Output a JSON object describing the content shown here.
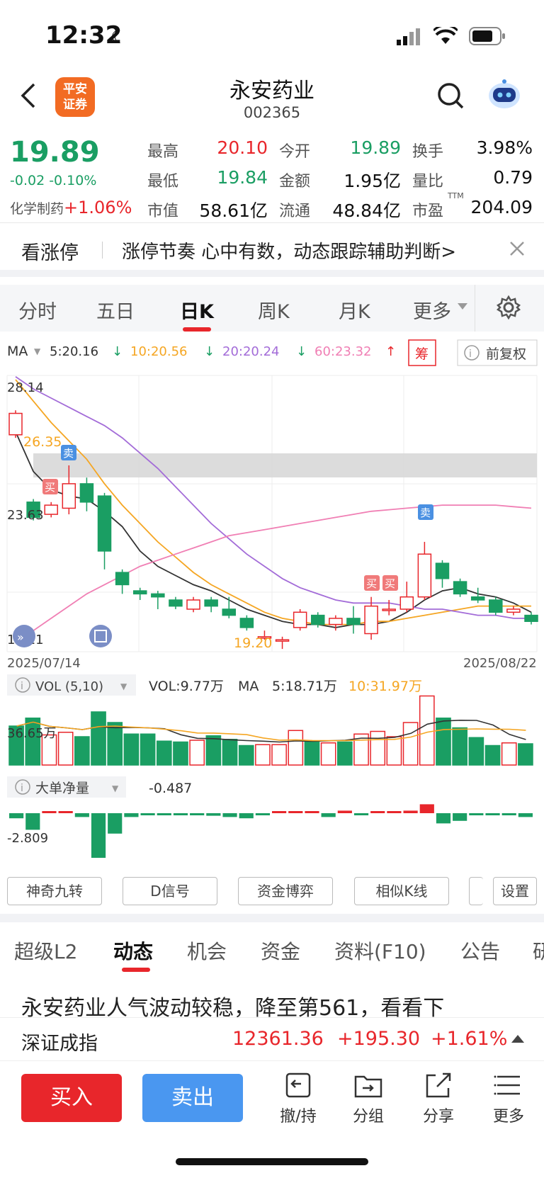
{
  "status_bar": {
    "time": "12:32"
  },
  "header": {
    "title": "永安药业",
    "code": "002365",
    "logo_text": "平安\n证券"
  },
  "quote": {
    "price": "19.89",
    "change": "-0.02 -0.10%",
    "sector_name": "化学制药",
    "sector_change": "+1.06%",
    "fields": [
      {
        "label": "最高",
        "value": "20.10",
        "color": "red"
      },
      {
        "label": "今开",
        "value": "19.89",
        "color": "green"
      },
      {
        "label": "换手",
        "value": "3.98%",
        "color": "dark"
      },
      {
        "label": "最低",
        "value": "19.84",
        "color": "green"
      },
      {
        "label": "金额",
        "value": "1.95亿",
        "color": "dark"
      },
      {
        "label": "量比",
        "value": "0.79",
        "color": "dark"
      },
      {
        "label": "市值",
        "value": "58.61亿",
        "color": "dark"
      },
      {
        "label": "流通",
        "value": "48.84亿",
        "color": "dark"
      },
      {
        "label": "市盈",
        "value": "204.09",
        "color": "dark",
        "sup": "TTM"
      }
    ]
  },
  "banner": {
    "tag": "看涨停",
    "text": "涨停节奏 心中有数，动态跟踪辅助判断>"
  },
  "period_tabs": [
    "分时",
    "五日",
    "日K",
    "周K",
    "月K",
    "更多"
  ],
  "active_period": "日K",
  "kline": {
    "ma_label": "MA",
    "ma_values": [
      {
        "text": "5:20.16",
        "color": "#333333"
      },
      {
        "text": "10:20.56",
        "color": "#f5a623"
      },
      {
        "text": "20:20.24",
        "color": "#a36cd8"
      },
      {
        "text": "60:23.32",
        "color": "#f07fb4"
      }
    ],
    "chou_label": "筹",
    "adjust_label": "前复权",
    "y_top": "28.14",
    "y_mid": "23.63",
    "y_bottom": "19.11",
    "high_mark": "26.35",
    "low_mark": "19.20",
    "date_start": "2025/07/14",
    "date_end": "2025/08/22",
    "sell_tag": "卖",
    "buy_tag": "买"
  },
  "chart_data": {
    "type": "candlestick",
    "x": [
      "2025/07/14",
      "2025/08/22"
    ],
    "ylim": [
      19.11,
      28.14
    ],
    "candles": [
      {
        "o": 26.2,
        "c": 26.9,
        "h": 27.0,
        "l": 26.1
      },
      {
        "o": 24.0,
        "c": 23.5,
        "h": 24.1,
        "l": 23.4
      },
      {
        "o": 23.6,
        "c": 23.9,
        "h": 24.0,
        "l": 23.5
      },
      {
        "o": 23.8,
        "c": 24.6,
        "h": 25.2,
        "l": 23.6
      },
      {
        "o": 24.6,
        "c": 24.0,
        "h": 24.8,
        "l": 23.7
      },
      {
        "o": 24.2,
        "c": 22.4,
        "h": 24.3,
        "l": 21.8
      },
      {
        "o": 21.7,
        "c": 21.3,
        "h": 21.8,
        "l": 21.0
      },
      {
        "o": 21.1,
        "c": 21.0,
        "h": 21.2,
        "l": 20.8
      },
      {
        "o": 21.0,
        "c": 20.9,
        "h": 21.1,
        "l": 20.5
      },
      {
        "o": 20.8,
        "c": 20.6,
        "h": 20.9,
        "l": 20.5
      },
      {
        "o": 20.5,
        "c": 20.8,
        "h": 20.9,
        "l": 20.4
      },
      {
        "o": 20.8,
        "c": 20.6,
        "h": 20.9,
        "l": 20.4
      },
      {
        "o": 20.5,
        "c": 20.3,
        "h": 20.9,
        "l": 20.2
      },
      {
        "o": 20.2,
        "c": 19.9,
        "h": 20.3,
        "l": 19.8
      },
      {
        "o": 19.6,
        "c": 19.6,
        "h": 19.8,
        "l": 19.5
      },
      {
        "o": 19.5,
        "c": 19.5,
        "h": 19.6,
        "l": 19.2
      },
      {
        "o": 19.9,
        "c": 20.4,
        "h": 20.5,
        "l": 19.8
      },
      {
        "o": 20.3,
        "c": 20.0,
        "h": 20.4,
        "l": 19.9
      },
      {
        "o": 20.0,
        "c": 20.2,
        "h": 20.3,
        "l": 19.8
      },
      {
        "o": 20.2,
        "c": 20.0,
        "h": 20.6,
        "l": 19.7
      },
      {
        "o": 19.7,
        "c": 20.6,
        "h": 20.9,
        "l": 19.5
      },
      {
        "o": 20.5,
        "c": 20.5,
        "h": 20.8,
        "l": 20.3
      },
      {
        "o": 20.5,
        "c": 20.9,
        "h": 21.4,
        "l": 20.4
      },
      {
        "o": 20.9,
        "c": 22.3,
        "h": 22.7,
        "l": 20.8
      },
      {
        "o": 22.0,
        "c": 21.5,
        "h": 22.1,
        "l": 21.2
      },
      {
        "o": 21.4,
        "c": 21.0,
        "h": 21.5,
        "l": 20.9
      },
      {
        "o": 20.9,
        "c": 20.8,
        "h": 21.2,
        "l": 20.7
      },
      {
        "o": 20.8,
        "c": 20.4,
        "h": 20.9,
        "l": 20.3
      },
      {
        "o": 20.4,
        "c": 20.5,
        "h": 20.6,
        "l": 20.3
      },
      {
        "o": 20.3,
        "c": 20.1,
        "h": 20.4,
        "l": 20.0
      }
    ],
    "series": [
      {
        "name": "5",
        "color": "#333333",
        "values": [
          26.3,
          25.0,
          24.4,
          24.2,
          24.1,
          23.7,
          23.2,
          22.4,
          21.9,
          21.6,
          21.3,
          21.1,
          20.8,
          20.5,
          20.3,
          20.1,
          20.0,
          20.0,
          19.9,
          20.0,
          20.0,
          20.1,
          20.4,
          20.8,
          21.1,
          21.2,
          21.0,
          20.9,
          20.7,
          20.4
        ]
      },
      {
        "name": "10",
        "color": "#f5a623",
        "values": [
          28.0,
          27.3,
          26.6,
          26.0,
          25.4,
          24.6,
          23.9,
          23.3,
          22.7,
          22.2,
          21.7,
          21.3,
          21.0,
          20.7,
          20.4,
          20.2,
          20.1,
          20.0,
          20.0,
          20.0,
          20.1,
          20.1,
          20.2,
          20.3,
          20.4,
          20.5,
          20.6,
          20.6,
          20.6,
          20.6
        ]
      },
      {
        "name": "20",
        "color": "#a36cd8",
        "values": [
          28.1,
          27.7,
          27.4,
          27.1,
          26.8,
          26.5,
          26.1,
          25.6,
          25.1,
          24.5,
          23.9,
          23.3,
          22.8,
          22.3,
          21.9,
          21.5,
          21.2,
          21.0,
          20.8,
          20.7,
          20.7,
          20.7,
          20.6,
          20.5,
          20.5,
          20.4,
          20.3,
          20.3,
          20.2,
          20.2
        ]
      },
      {
        "name": "60",
        "color": "#f07fb4",
        "values": [
          19.4,
          19.8,
          20.2,
          20.6,
          21.0,
          21.3,
          21.6,
          21.9,
          22.1,
          22.3,
          22.5,
          22.7,
          22.9,
          23.0,
          23.1,
          23.2,
          23.3,
          23.4,
          23.5,
          23.6,
          23.7,
          23.75,
          23.8,
          23.85,
          23.9,
          23.9,
          23.9,
          23.9,
          23.85,
          23.8
        ]
      }
    ],
    "volume": [
      44,
      53,
      34,
      37,
      32,
      60,
      48,
      35,
      35,
      27,
      26,
      28,
      33,
      29,
      22,
      23,
      23,
      39,
      27,
      25,
      26,
      35,
      38,
      32,
      48,
      78,
      53,
      42,
      31,
      22,
      25,
      24
    ],
    "volume_up": [
      false,
      false,
      true,
      true,
      false,
      false,
      false,
      false,
      false,
      false,
      false,
      true,
      false,
      false,
      false,
      true,
      true,
      true,
      false,
      true,
      false,
      true,
      true,
      true,
      true,
      true,
      false,
      false,
      false,
      false,
      true,
      false
    ],
    "big_order_net": [
      -0.4,
      -1.3,
      0.05,
      0.1,
      -0.3,
      -3.5,
      -1.6,
      -0.3,
      -0.1,
      -0.1,
      -0.1,
      -0.1,
      -0.2,
      -0.3,
      -0.4,
      -0.1,
      0.05,
      0.05,
      0.05,
      -0.3,
      0.2,
      -0.15,
      0.1,
      0.1,
      0.2,
      0.7,
      -0.8,
      -0.6,
      -0.1,
      -0.1,
      -0.05,
      -0.3
    ]
  },
  "volume_panel": {
    "label": "VOL (5,10)",
    "vol": "VOL:9.77万",
    "ma": "MA",
    "ma5": "5:18.71万",
    "ma10": "10:31.97万",
    "axis": "36.65万"
  },
  "bigorder_panel": {
    "label": "大单净量",
    "value": "-0.487",
    "axis": "-2.809"
  },
  "tool_buttons": [
    "神奇九转",
    "D信号",
    "资金博弈",
    "相似K线",
    "",
    "设置"
  ],
  "bottom_tabs": [
    "超级L2",
    "动态",
    "机会",
    "资金",
    "资料(F10)",
    "公告",
    "研"
  ],
  "active_bottom_tab": "动态",
  "news_headline": "永安药业人气波动较稳，降至第561，看看下",
  "index_bar": {
    "name": "深证成指",
    "value": "12361.36",
    "change": "+195.30",
    "pct": "+1.61%"
  },
  "actions": {
    "buy": "买入",
    "sell": "卖出",
    "items": [
      "撤/持",
      "分组",
      "分享",
      "更多"
    ]
  }
}
